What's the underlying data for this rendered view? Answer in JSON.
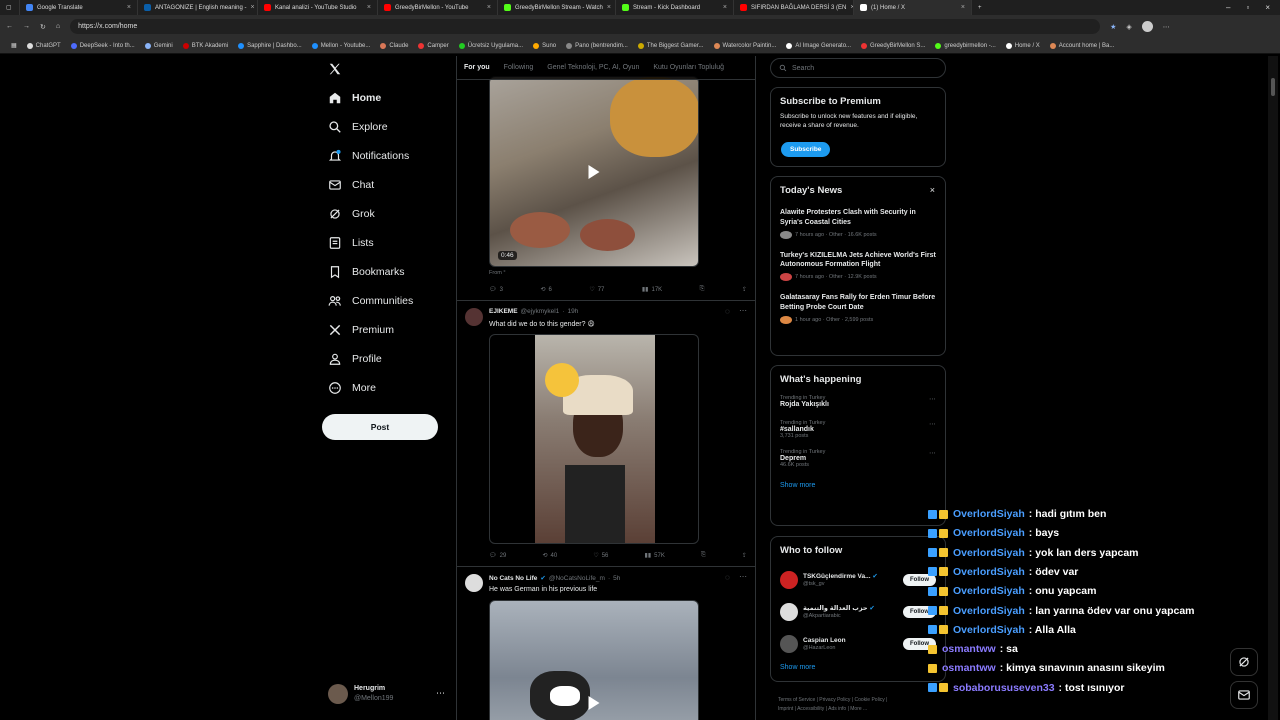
{
  "browser": {
    "tabs": [
      {
        "title": "Google Translate",
        "color": "#4285f4"
      },
      {
        "title": "ANTAGONIZE | English meaning -",
        "color": "#0a5ea8"
      },
      {
        "title": "Kanal analizi - YouTube Studio",
        "color": "#ff0000"
      },
      {
        "title": "GreedyBirMellon - YouTube",
        "color": "#ff0000"
      },
      {
        "title": "GreedyBirMellon Stream - Watch",
        "color": "#53fc18"
      },
      {
        "title": "Stream - Kick Dashboard",
        "color": "#53fc18"
      },
      {
        "title": "SIFIRDAN BAĞLAMA DERSİ 3 (EN",
        "color": "#ff0000"
      },
      {
        "title": "(1) Home / X",
        "color": "#ffffff"
      }
    ],
    "url": "https://x.com/home",
    "bookmarks": [
      {
        "label": "ChatGPT",
        "color": "#ddd"
      },
      {
        "label": "DeepSeek - Into th...",
        "color": "#4d6bfe"
      },
      {
        "label": "Gemini",
        "color": "#8ab4f8"
      },
      {
        "label": "BTK Akademi",
        "color": "#c00"
      },
      {
        "label": "Sapphire | Dashbo...",
        "color": "#1e90ff"
      },
      {
        "label": "Mellon - Youtube...",
        "color": "#1e90ff"
      },
      {
        "label": "Claude",
        "color": "#d97757"
      },
      {
        "label": "Camper",
        "color": "#e33"
      },
      {
        "label": "Ücretsiz Uygulama...",
        "color": "#2c2"
      },
      {
        "label": "Suno",
        "color": "#fa0"
      },
      {
        "label": "Pano (bentrendim...",
        "color": "#888"
      },
      {
        "label": "The Biggest Gamer...",
        "color": "#ca0"
      },
      {
        "label": "Watercolor Paintin...",
        "color": "#d85"
      },
      {
        "label": "AI Image Generato...",
        "color": "#fff"
      },
      {
        "label": "GreedyBirMellon S...",
        "color": "#e33"
      },
      {
        "label": "greedybirmellon -...",
        "color": "#53fc18"
      },
      {
        "label": "Home / X",
        "color": "#fff"
      },
      {
        "label": "Account home | Ba...",
        "color": "#d85"
      }
    ]
  },
  "sidebar": {
    "items": [
      {
        "label": "Home",
        "bold": true
      },
      {
        "label": "Explore"
      },
      {
        "label": "Notifications"
      },
      {
        "label": "Chat"
      },
      {
        "label": "Grok"
      },
      {
        "label": "Lists"
      },
      {
        "label": "Bookmarks"
      },
      {
        "label": "Communities"
      },
      {
        "label": "Premium"
      },
      {
        "label": "Profile"
      },
      {
        "label": "More"
      }
    ],
    "post_label": "Post",
    "user": {
      "name": "Herugrim",
      "handle": "@Mellon199"
    }
  },
  "feed": {
    "tabs": [
      "For you",
      "Following",
      "Genel Teknoloji, PC, AI, Oyun",
      "Kutu Oyunları Topluluğ"
    ],
    "tweet1": {
      "duration": "0:46",
      "from": "From",
      "replies": "3",
      "reposts": "6",
      "likes": "77",
      "views": "17K"
    },
    "tweet2": {
      "name": "EJIKEME",
      "handle": "@ejykmykel1",
      "time": "19h",
      "text": "What did we do to this gender?",
      "replies": "29",
      "reposts": "40",
      "likes": "56",
      "views": "57K"
    },
    "tweet3": {
      "name": "No Cats No Life",
      "handle": "@NoCatsNoLife_m",
      "time": "5h",
      "text": "He was German in his previous life"
    }
  },
  "right": {
    "search_placeholder": "Search",
    "premium": {
      "title": "Subscribe to Premium",
      "body": "Subscribe to unlock new features and if eligible, receive a share of revenue.",
      "button": "Subscribe"
    },
    "news": {
      "title": "Today's News",
      "items": [
        {
          "headline": "Alawite Protesters Clash with Security in Syria's Coastal Cities",
          "meta": "7 hours ago · Other · 16.6K posts"
        },
        {
          "headline": "Turkey's KIZILELMA Jets Achieve World's First Autonomous Formation Flight",
          "meta": "7 hours ago · Other · 12.9K posts"
        },
        {
          "headline": "Galatasaray Fans Rally for Erden Timur Before Betting Probe Court Date",
          "meta": "1 hour ago · Other · 2,599 posts"
        }
      ]
    },
    "happening": {
      "title": "What's happening",
      "items": [
        {
          "context": "Trending in Turkey",
          "topic": "Rojda Yakışıklı",
          "posts": ""
        },
        {
          "context": "Trending in Turkey",
          "topic": "#sallandık",
          "posts": "3,731 posts"
        },
        {
          "context": "Trending in Turkey",
          "topic": "Deprem",
          "posts": "46.6K posts"
        }
      ],
      "show_more": "Show more"
    },
    "who": {
      "title": "Who to follow",
      "items": [
        {
          "name": "TSKGüçlendirme Va...",
          "handle": "@tsk_gv",
          "button": "Follow"
        },
        {
          "name": "حزب العدالة والتنمية",
          "handle": "@Akpartiarabic",
          "button": "Follow"
        },
        {
          "name": "Caspian Leon",
          "handle": "@HazarLeon",
          "button": "Follow"
        }
      ],
      "show_more": "Show more"
    },
    "footer": {
      "line1": "Terms of Service | Privacy Policy | Cookie Policy |",
      "line2": "Imprint | Accessibility | Ads info | More ..."
    }
  },
  "chat": [
    {
      "user": "OverlordSiyah",
      "msg": ": hadi gıtım ben",
      "badges": 2
    },
    {
      "user": "OverlordSiyah",
      "msg": ": bays",
      "badges": 2
    },
    {
      "user": "OverlordSiyah",
      "msg": ": yok lan ders yapcam",
      "badges": 2
    },
    {
      "user": "OverlordSiyah",
      "msg": ": ödev var",
      "badges": 2
    },
    {
      "user": "OverlordSiyah",
      "msg": ": onu yapcam",
      "badges": 2
    },
    {
      "user": "OverlordSiyah",
      "msg": ": lan yarına ödev var onu yapcam",
      "badges": 2
    },
    {
      "user": "OverlordSiyah",
      "msg": ": Alla Alla",
      "badges": 2
    },
    {
      "user": "osmantww",
      "msg": ": sa",
      "badges": 1
    },
    {
      "user": "osmantww",
      "msg": ": kimya sınavının anasını sikeyim",
      "badges": 1
    },
    {
      "user": "sobaborususeven33",
      "msg": ": tost ısınıyor",
      "badges": 2
    }
  ]
}
